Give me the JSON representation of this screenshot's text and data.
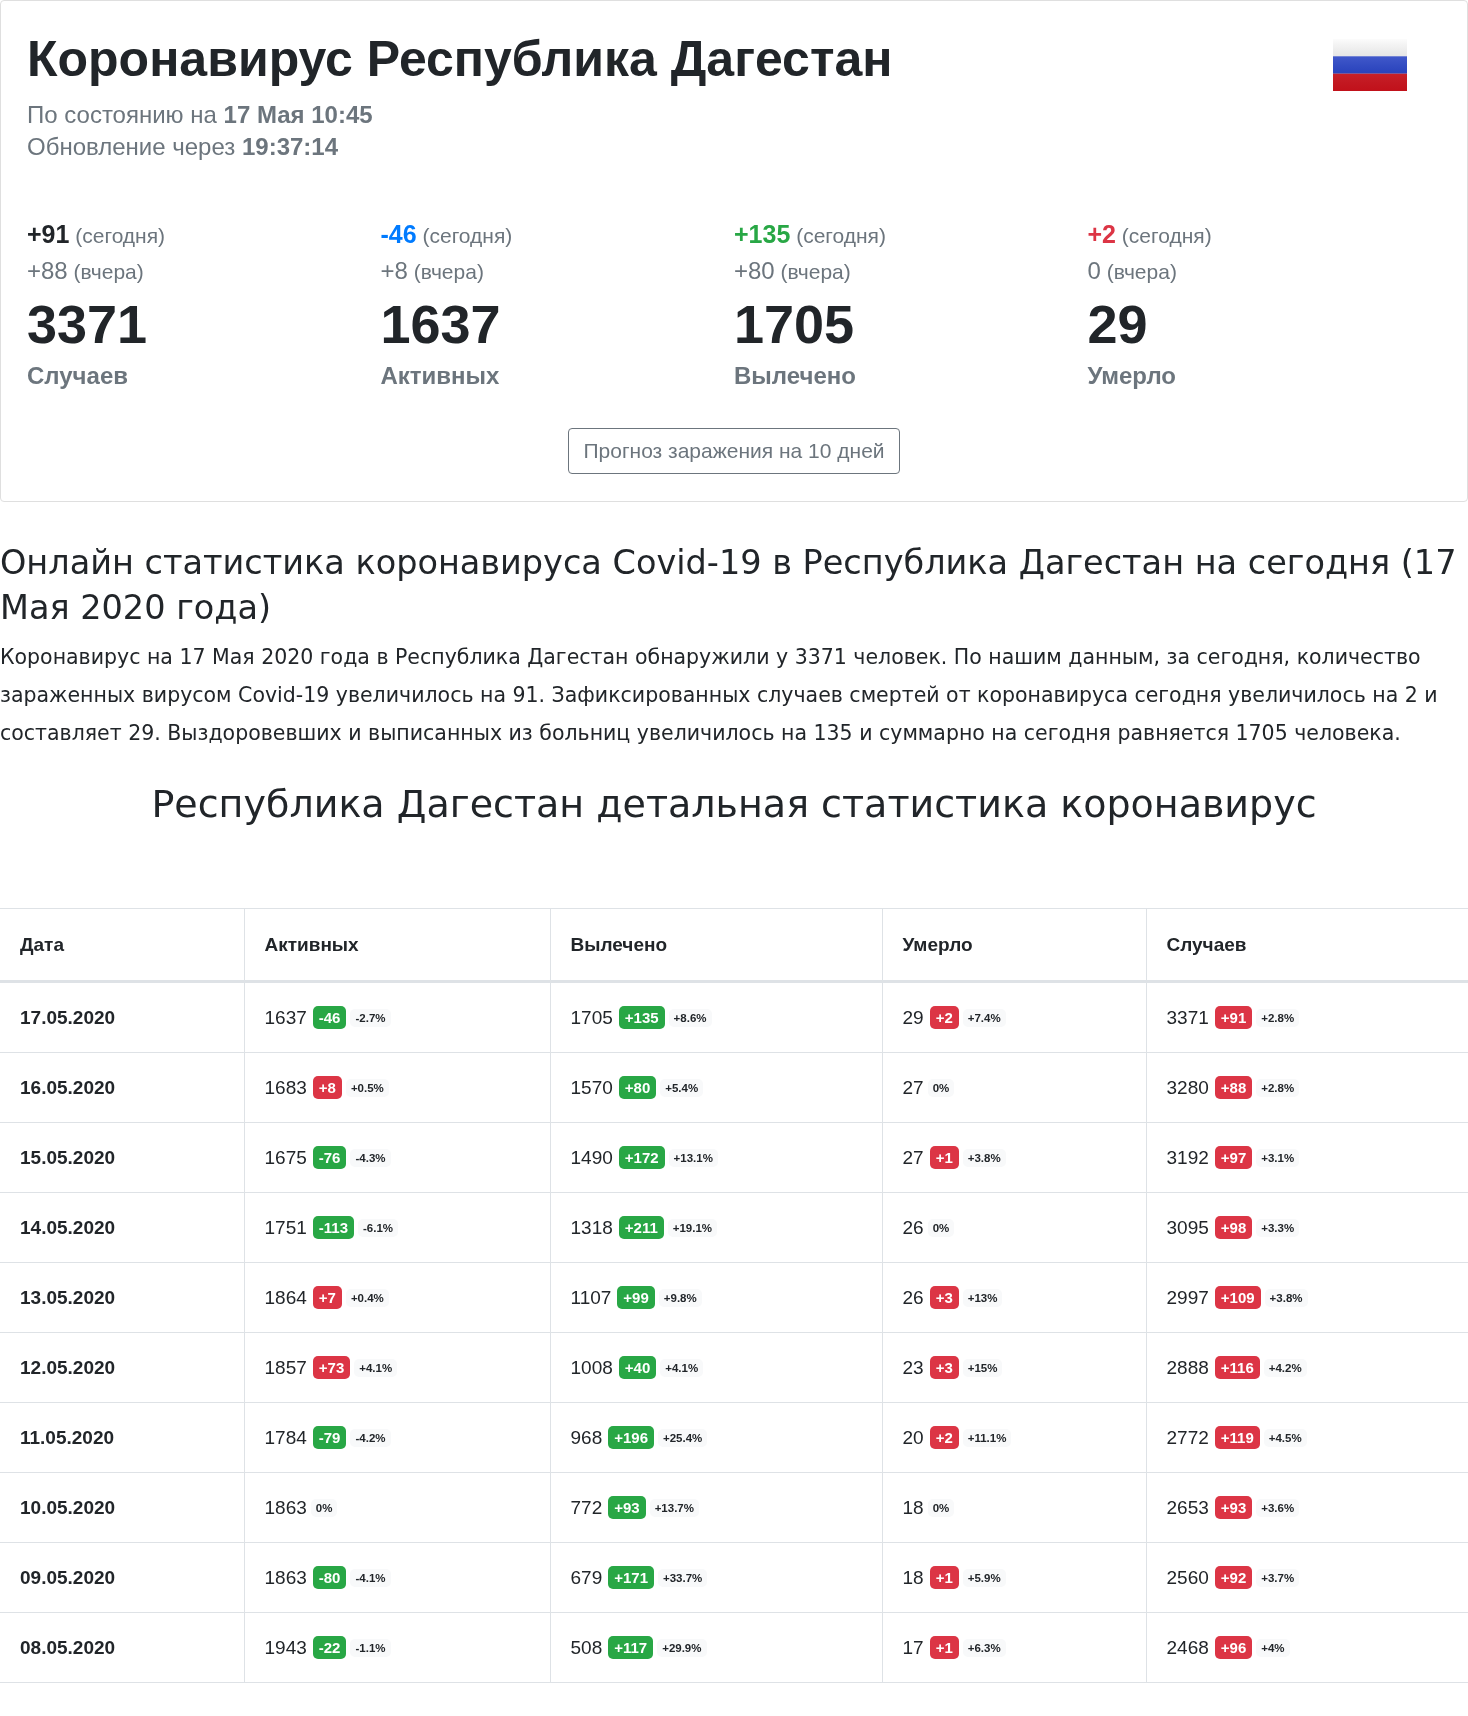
{
  "header": {
    "title": "Коронавирус Республика Дагестан",
    "status_prefix": "По состоянию на",
    "status_value": "17 Мая 10:45",
    "update_prefix": "Обновление через",
    "update_value": "19:37:14"
  },
  "stats": [
    {
      "today": "+91",
      "today_note": "(сегодня)",
      "color": "#212529",
      "yesterday": "+88",
      "yesterday_note": "(вчера)",
      "total": "3371",
      "label": "Случаев"
    },
    {
      "today": "-46",
      "today_note": "(сегодня)",
      "color": "#007bff",
      "yesterday": "+8",
      "yesterday_note": "(вчера)",
      "total": "1637",
      "label": "Активных"
    },
    {
      "today": "+135",
      "today_note": "(сегодня)",
      "color": "#28a745",
      "yesterday": "+80",
      "yesterday_note": "(вчера)",
      "total": "1705",
      "label": "Вылечено"
    },
    {
      "today": "+2",
      "today_note": "(сегодня)",
      "color": "#dc3545",
      "yesterday": "0",
      "yesterday_note": "(вчера)",
      "total": "29",
      "label": "Умерло"
    }
  ],
  "forecast_button": "Прогноз заражения на 10 дней",
  "article": {
    "heading": "Онлайн статистика коронавируса Covid-19 в Республика Дагестан на сегодня (17 Мая 2020 года)",
    "text": "Коронавирус на 17 Мая 2020 года в Республика Дагестан обнаружили у 3371 человек. По нашим данным, за сегодня, количество зараженных вирусом Covid-19 увеличилось на 91. Зафиксированных случаев смертей от коронавируса сегодня увеличилось на 2 и составляет 29. Выздоровевших и выписанных из больниц увеличилось на 135 и суммарно на сегодня равняется 1705 человека."
  },
  "table_title": "Республика Дагестан детальная статистика коронавирус",
  "table": {
    "columns": [
      "Дата",
      "Активных",
      "Вылечено",
      "Умерло",
      "Случаев"
    ],
    "rows": [
      {
        "cells": [
          {
            "kind": "date",
            "value": "17.05.2020"
          },
          {
            "kind": "count",
            "value": "1637",
            "delta": "-46",
            "color": "#28a745",
            "percent": "-2.7%"
          },
          {
            "kind": "count",
            "value": "1705",
            "delta": "+135",
            "color": "#28a745",
            "percent": "+8.6%"
          },
          {
            "kind": "count",
            "value": "29",
            "delta": "+2",
            "color": "#dc3545",
            "percent": "+7.4%"
          },
          {
            "kind": "count",
            "value": "3371",
            "delta": "+91",
            "color": "#dc3545",
            "percent": "+2.8%"
          }
        ]
      },
      {
        "cells": [
          {
            "kind": "date",
            "value": "16.05.2020"
          },
          {
            "kind": "count",
            "value": "1683",
            "delta": "+8",
            "color": "#dc3545",
            "percent": "+0.5%"
          },
          {
            "kind": "count",
            "value": "1570",
            "delta": "+80",
            "color": "#28a745",
            "percent": "+5.4%"
          },
          {
            "kind": "count",
            "value": "27",
            "percent": "0%"
          },
          {
            "kind": "count",
            "value": "3280",
            "delta": "+88",
            "color": "#dc3545",
            "percent": "+2.8%"
          }
        ]
      },
      {
        "cells": [
          {
            "kind": "date",
            "value": "15.05.2020"
          },
          {
            "kind": "count",
            "value": "1675",
            "delta": "-76",
            "color": "#28a745",
            "percent": "-4.3%"
          },
          {
            "kind": "count",
            "value": "1490",
            "delta": "+172",
            "color": "#28a745",
            "percent": "+13.1%"
          },
          {
            "kind": "count",
            "value": "27",
            "delta": "+1",
            "color": "#dc3545",
            "percent": "+3.8%"
          },
          {
            "kind": "count",
            "value": "3192",
            "delta": "+97",
            "color": "#dc3545",
            "percent": "+3.1%"
          }
        ]
      },
      {
        "cells": [
          {
            "kind": "date",
            "value": "14.05.2020"
          },
          {
            "kind": "count",
            "value": "1751",
            "delta": "-113",
            "color": "#28a745",
            "percent": "-6.1%"
          },
          {
            "kind": "count",
            "value": "1318",
            "delta": "+211",
            "color": "#28a745",
            "percent": "+19.1%"
          },
          {
            "kind": "count",
            "value": "26",
            "percent": "0%"
          },
          {
            "kind": "count",
            "value": "3095",
            "delta": "+98",
            "color": "#dc3545",
            "percent": "+3.3%"
          }
        ]
      },
      {
        "cells": [
          {
            "kind": "date",
            "value": "13.05.2020"
          },
          {
            "kind": "count",
            "value": "1864",
            "delta": "+7",
            "color": "#dc3545",
            "percent": "+0.4%"
          },
          {
            "kind": "count",
            "value": "1107",
            "delta": "+99",
            "color": "#28a745",
            "percent": "+9.8%"
          },
          {
            "kind": "count",
            "value": "26",
            "delta": "+3",
            "color": "#dc3545",
            "percent": "+13%"
          },
          {
            "kind": "count",
            "value": "2997",
            "delta": "+109",
            "color": "#dc3545",
            "percent": "+3.8%"
          }
        ]
      },
      {
        "cells": [
          {
            "kind": "date",
            "value": "12.05.2020"
          },
          {
            "kind": "count",
            "value": "1857",
            "delta": "+73",
            "color": "#dc3545",
            "percent": "+4.1%"
          },
          {
            "kind": "count",
            "value": "1008",
            "delta": "+40",
            "color": "#28a745",
            "percent": "+4.1%"
          },
          {
            "kind": "count",
            "value": "23",
            "delta": "+3",
            "color": "#dc3545",
            "percent": "+15%"
          },
          {
            "kind": "count",
            "value": "2888",
            "delta": "+116",
            "color": "#dc3545",
            "percent": "+4.2%"
          }
        ]
      },
      {
        "cells": [
          {
            "kind": "date",
            "value": "11.05.2020"
          },
          {
            "kind": "count",
            "value": "1784",
            "delta": "-79",
            "color": "#28a745",
            "percent": "-4.2%"
          },
          {
            "kind": "count",
            "value": "968",
            "delta": "+196",
            "color": "#28a745",
            "percent": "+25.4%"
          },
          {
            "kind": "count",
            "value": "20",
            "delta": "+2",
            "color": "#dc3545",
            "percent": "+11.1%"
          },
          {
            "kind": "count",
            "value": "2772",
            "delta": "+119",
            "color": "#dc3545",
            "percent": "+4.5%"
          }
        ]
      },
      {
        "cells": [
          {
            "kind": "date",
            "value": "10.05.2020"
          },
          {
            "kind": "count",
            "value": "1863",
            "percent": "0%"
          },
          {
            "kind": "count",
            "value": "772",
            "delta": "+93",
            "color": "#28a745",
            "percent": "+13.7%"
          },
          {
            "kind": "count",
            "value": "18",
            "percent": "0%"
          },
          {
            "kind": "count",
            "value": "2653",
            "delta": "+93",
            "color": "#dc3545",
            "percent": "+3.6%"
          }
        ]
      },
      {
        "cells": [
          {
            "kind": "date",
            "value": "09.05.2020"
          },
          {
            "kind": "count",
            "value": "1863",
            "delta": "-80",
            "color": "#28a745",
            "percent": "-4.1%"
          },
          {
            "kind": "count",
            "value": "679",
            "delta": "+171",
            "color": "#28a745",
            "percent": "+33.7%"
          },
          {
            "kind": "count",
            "value": "18",
            "delta": "+1",
            "color": "#dc3545",
            "percent": "+5.9%"
          },
          {
            "kind": "count",
            "value": "2560",
            "delta": "+92",
            "color": "#dc3545",
            "percent": "+3.7%"
          }
        ]
      },
      {
        "cells": [
          {
            "kind": "date",
            "value": "08.05.2020"
          },
          {
            "kind": "count",
            "value": "1943",
            "delta": "-22",
            "color": "#28a745",
            "percent": "-1.1%"
          },
          {
            "kind": "count",
            "value": "508",
            "delta": "+117",
            "color": "#28a745",
            "percent": "+29.9%"
          },
          {
            "kind": "count",
            "value": "17",
            "delta": "+1",
            "color": "#dc3545",
            "percent": "+6.3%"
          },
          {
            "kind": "count",
            "value": "2468",
            "delta": "+96",
            "color": "#dc3545",
            "percent": "+4%"
          }
        ]
      }
    ]
  }
}
